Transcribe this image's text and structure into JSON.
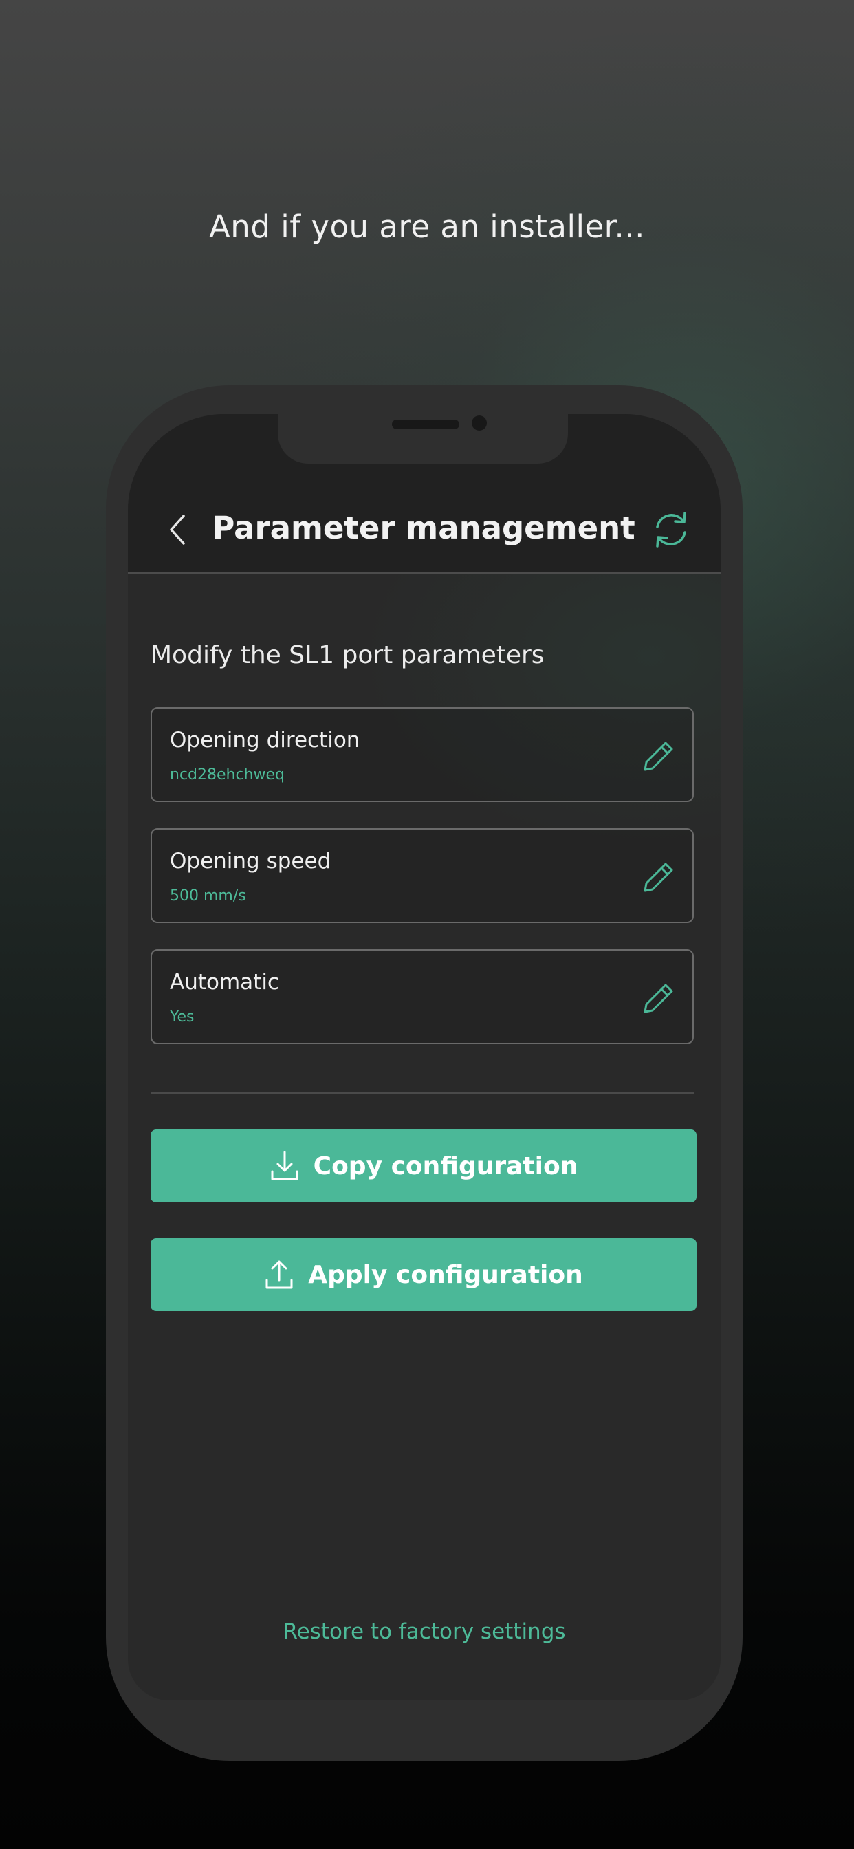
{
  "tagline": "And if you are an installer...",
  "header": {
    "title": "Parameter management",
    "back_icon": "chevron-left-icon",
    "refresh_icon": "refresh-icon"
  },
  "section_title": "Modify the SL1 port parameters",
  "parameters": [
    {
      "label": "Opening direction",
      "value": "ncd28ehchweq",
      "icon": "pencil-icon"
    },
    {
      "label": "Opening speed",
      "value": "500 mm/s",
      "icon": "pencil-icon"
    },
    {
      "label": "Automatic",
      "value": "Yes",
      "icon": "pencil-icon"
    }
  ],
  "actions": {
    "copy_label": "Copy configuration",
    "copy_icon": "download-icon",
    "apply_label": "Apply configuration",
    "apply_icon": "upload-icon"
  },
  "restore_label": "Restore to factory settings",
  "colors": {
    "accent": "#4bb898",
    "screen_bg": "#292929",
    "phone_frame": "#2f2f2f"
  }
}
